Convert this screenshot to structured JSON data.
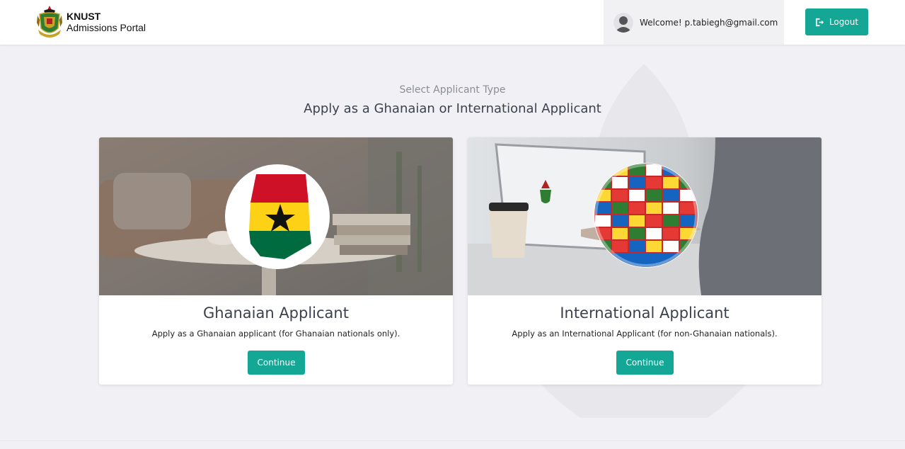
{
  "header": {
    "brand_title": "KNUST",
    "brand_subtitle": "Admissions Portal",
    "welcome_text": "Welcome! p.tabiegh@gmail.com",
    "logout_label": "Logout"
  },
  "main": {
    "subheading": "Select Applicant Type",
    "heading": "Apply as a Ghanaian or International Applicant"
  },
  "cards": [
    {
      "title": "Ghanaian Applicant",
      "description": "Apply as a Ghanaian applicant (for Ghanaian nationals only).",
      "button_label": "Continue",
      "image_icon": "ghana-map-flag-icon"
    },
    {
      "title": "International Applicant",
      "description": "Apply as an International Applicant (for non-Ghanaian nationals).",
      "button_label": "Continue",
      "image_icon": "flag-globe-icon"
    }
  ],
  "colors": {
    "accent": "#14a795",
    "background": "#f1f1f5",
    "ghana_red": "#ce1126",
    "ghana_gold": "#fcd116",
    "ghana_green": "#006b3f"
  }
}
